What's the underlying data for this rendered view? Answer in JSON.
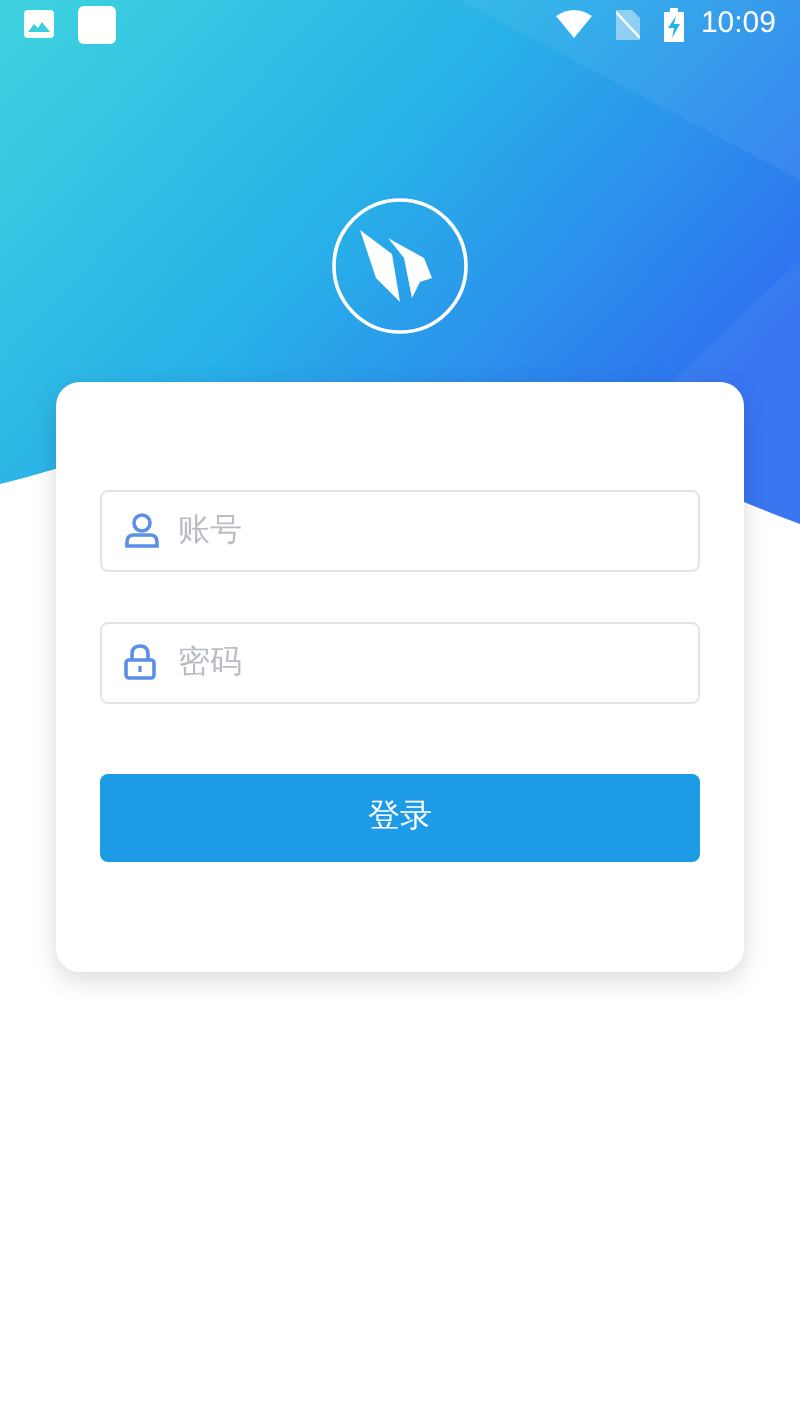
{
  "status_bar": {
    "time": "10:09"
  },
  "login_form": {
    "fields": [
      {
        "kind": "account",
        "placeholder": "账号"
      },
      {
        "kind": "password",
        "placeholder": "密码"
      }
    ],
    "submit_button": "登录"
  }
}
